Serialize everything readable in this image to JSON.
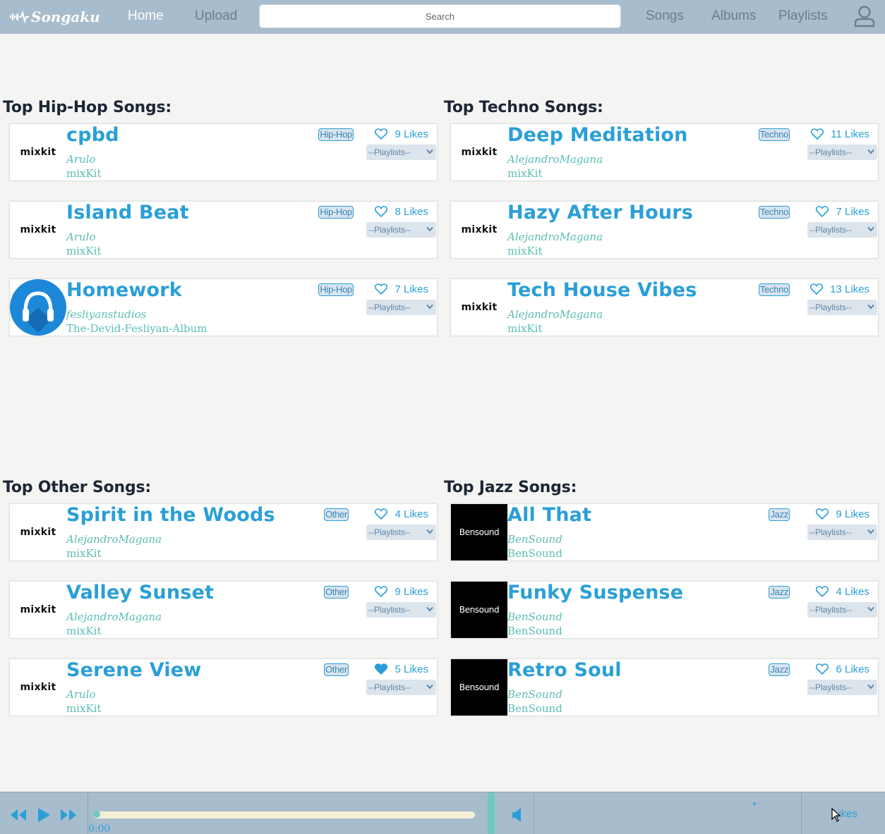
{
  "app": {
    "logo_text": "Songaku",
    "accent": "#2a9fd6",
    "navbar_color": "#a7bccd"
  },
  "nav": {
    "home": "Home",
    "upload": "Upload",
    "search_placeholder": "Search",
    "songs": "Songs",
    "albums": "Albums",
    "playlists": "Playlists",
    "user_icon": "user-icon"
  },
  "sections": [
    {
      "title": "Top Hip-Hop Songs:",
      "songs": [
        {
          "title": "cpbd",
          "artist": "Arulo",
          "album": "mixKit",
          "genre": "Hip-Hop",
          "likes": "9 Likes",
          "liked": false,
          "thumb": "mixkit",
          "thumb_text": "mixkit",
          "playlist": "--Playlists--"
        },
        {
          "title": "Island Beat",
          "artist": "Arulo",
          "album": "mixKit",
          "genre": "Hip-Hop",
          "likes": "8 Likes",
          "liked": false,
          "thumb": "mixkit",
          "thumb_text": "mixkit",
          "playlist": "--Playlists--"
        },
        {
          "title": "Homework",
          "artist": "fesliyanstudios",
          "album": "The-Devid-Fesliyan-Album",
          "genre": "Hip-Hop",
          "likes": "7 Likes",
          "liked": false,
          "thumb": "fesliyan",
          "thumb_text": "",
          "playlist": "--Playlists--"
        }
      ]
    },
    {
      "title": "Top Techno Songs:",
      "songs": [
        {
          "title": "Deep Meditation",
          "artist": "AlejandroMagana",
          "album": "mixKit",
          "genre": "Techno",
          "likes": "11 Likes",
          "liked": false,
          "thumb": "mixkit",
          "thumb_text": "mixkit",
          "playlist": "--Playlists--"
        },
        {
          "title": "Hazy After Hours",
          "artist": "AlejandroMagana",
          "album": "mixKit",
          "genre": "Techno",
          "likes": "7 Likes",
          "liked": false,
          "thumb": "mixkit",
          "thumb_text": "mixkit",
          "playlist": "--Playlists--"
        },
        {
          "title": "Tech House Vibes",
          "artist": "AlejandroMagana",
          "album": "mixKit",
          "genre": "Techno",
          "likes": "13 Likes",
          "liked": false,
          "thumb": "mixkit",
          "thumb_text": "mixkit",
          "playlist": "--Playlists--"
        }
      ]
    },
    {
      "title": "Top Other Songs:",
      "songs": [
        {
          "title": "Spirit in the Woods",
          "artist": "AlejandroMagana",
          "album": "mixKit",
          "genre": "Other",
          "likes": "4 Likes",
          "liked": false,
          "thumb": "mixkit",
          "thumb_text": "mixkit",
          "playlist": "--Playlists--"
        },
        {
          "title": "Valley Sunset",
          "artist": "AlejandroMagana",
          "album": "mixKit",
          "genre": "Other",
          "likes": "9 Likes",
          "liked": false,
          "thumb": "mixkit",
          "thumb_text": "mixkit",
          "playlist": "--Playlists--"
        },
        {
          "title": "Serene View",
          "artist": "Arulo",
          "album": "mixKit",
          "genre": "Other",
          "likes": "5 Likes",
          "liked": true,
          "thumb": "mixkit",
          "thumb_text": "mixkit",
          "playlist": "--Playlists--"
        }
      ]
    },
    {
      "title": "Top Jazz Songs:",
      "songs": [
        {
          "title": "All That",
          "artist": "BenSound",
          "album": "BenSound",
          "genre": "Jazz",
          "likes": "9 Likes",
          "liked": false,
          "thumb": "bensound",
          "thumb_text": "Bensound",
          "playlist": "--Playlists--"
        },
        {
          "title": "Funky Suspense",
          "artist": "BenSound",
          "album": "BenSound",
          "genre": "Jazz",
          "likes": "4 Likes",
          "liked": false,
          "thumb": "bensound",
          "thumb_text": "Bensound",
          "playlist": "--Playlists--"
        },
        {
          "title": "Retro Soul",
          "artist": "BenSound",
          "album": "BenSound",
          "genre": "Jazz",
          "likes": "6 Likes",
          "liked": false,
          "thumb": "bensound",
          "thumb_text": "Bensound",
          "playlist": "--Playlists--"
        }
      ]
    }
  ],
  "player": {
    "time": "0:00",
    "progress": 0,
    "likes_label": "Likes",
    "icons": [
      "rewind-icon",
      "play-icon",
      "fast-forward-icon",
      "volume-icon"
    ]
  }
}
